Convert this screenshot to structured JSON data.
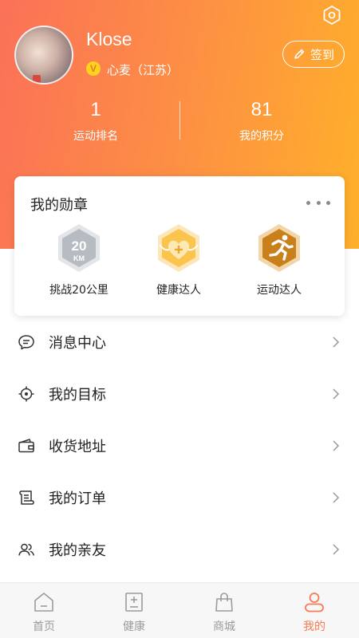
{
  "profile": {
    "username": "Klose",
    "verified_mark": "V",
    "location": "心麦（江苏）",
    "signin_label": "签到"
  },
  "stats": [
    {
      "value": "1",
      "label": "运动排名"
    },
    {
      "value": "81",
      "label": "我的积分"
    }
  ],
  "medals": {
    "title": "我的勋章",
    "items": [
      {
        "label": "挑战20公里",
        "icon": "20km-medal-icon",
        "emblem": "20",
        "unit": "KM"
      },
      {
        "label": "健康达人",
        "icon": "health-heart-medal-icon"
      },
      {
        "label": "运动达人",
        "icon": "runner-medal-icon"
      }
    ]
  },
  "menu": [
    {
      "label": "消息中心",
      "icon": "message-icon"
    },
    {
      "label": "我的目标",
      "icon": "target-icon"
    },
    {
      "label": "收货地址",
      "icon": "wallet-icon"
    },
    {
      "label": "我的订单",
      "icon": "order-scroll-icon"
    },
    {
      "label": "我的亲友",
      "icon": "friends-icon"
    }
  ],
  "tabs": [
    {
      "label": "首页",
      "icon": "home-icon",
      "active": false
    },
    {
      "label": "健康",
      "icon": "health-icon",
      "active": false
    },
    {
      "label": "商城",
      "icon": "shop-bag-icon",
      "active": false
    },
    {
      "label": "我的",
      "icon": "profile-icon",
      "active": true
    }
  ],
  "colors": {
    "gradient_start": "#fb7158",
    "gradient_end": "#feb02a",
    "accent": "#fb7a56",
    "inactive_tab": "#9b9b9b"
  }
}
